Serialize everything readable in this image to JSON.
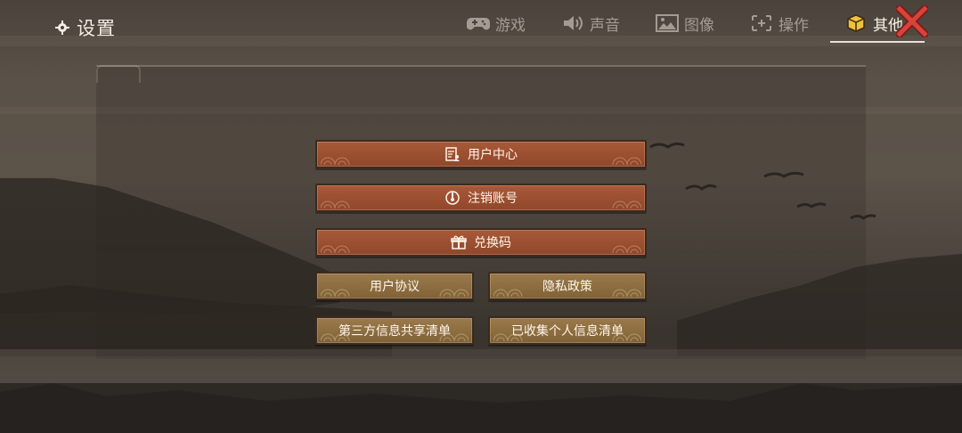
{
  "header": {
    "title": "设置",
    "title_icon": "gear-icon"
  },
  "tabs": [
    {
      "label": "游戏",
      "icon": "gamepad-icon",
      "active": false
    },
    {
      "label": "声音",
      "icon": "speaker-icon",
      "active": false
    },
    {
      "label": "图像",
      "icon": "image-icon",
      "active": false
    },
    {
      "label": "操作",
      "icon": "crosshair-icon",
      "active": false
    },
    {
      "label": "其他",
      "icon": "box-icon",
      "active": true
    }
  ],
  "close": {
    "icon": "close-icon"
  },
  "buttons": {
    "user_center": {
      "label": "用户中心",
      "icon": "document-user-icon"
    },
    "cancel_account": {
      "label": "注销账号",
      "icon": "power-icon"
    },
    "redeem_code": {
      "label": "兑换码",
      "icon": "gift-icon"
    },
    "user_agreement": {
      "label": "用户协议"
    },
    "privacy_policy": {
      "label": "隐私政策"
    },
    "third_party_list": {
      "label": "第三方信息共享清单"
    },
    "collected_info_list": {
      "label": "已收集个人信息清单"
    }
  },
  "colors": {
    "primary_button": "#9b4f31",
    "secondary_button": "#8c6d40",
    "close_red": "#c23a32",
    "active_tab": "#f7f1e6",
    "inactive_tab": "#a39c93"
  }
}
